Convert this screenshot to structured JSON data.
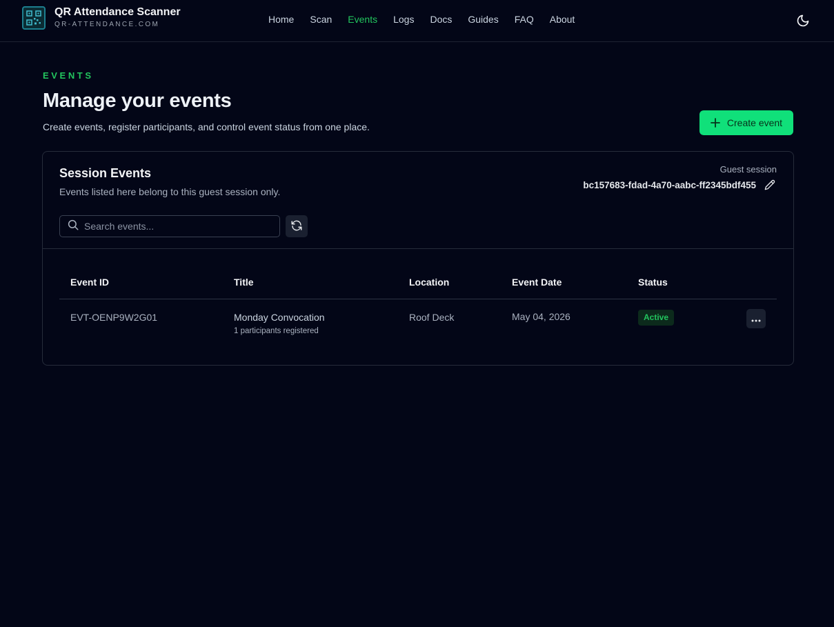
{
  "brand": {
    "title": "QR Attendance Scanner",
    "subtitle": "QR-ATTENDANCE.COM"
  },
  "nav": {
    "items": [
      {
        "label": "Home",
        "active": false
      },
      {
        "label": "Scan",
        "active": false
      },
      {
        "label": "Events",
        "active": true
      },
      {
        "label": "Logs",
        "active": false
      },
      {
        "label": "Docs",
        "active": false
      },
      {
        "label": "Guides",
        "active": false
      },
      {
        "label": "FAQ",
        "active": false
      },
      {
        "label": "About",
        "active": false
      }
    ],
    "theme_icon": "moon-icon"
  },
  "page": {
    "eyebrow": "EVENTS",
    "title": "Manage your events",
    "description": "Create events, register participants, and control event status from one place.",
    "create_button": "Create event"
  },
  "card": {
    "title": "Session Events",
    "subtitle": "Events listed here belong to this guest session only.",
    "session_label": "Guest session",
    "session_id": "bc157683-fdad-4a70-aabc-ff2345bdf455",
    "search_placeholder": "Search events...",
    "search_value": ""
  },
  "table": {
    "columns": [
      "Event ID",
      "Title",
      "Location",
      "Event Date",
      "Status"
    ],
    "rows": [
      {
        "event_id": "EVT-OENP9W2G01",
        "title": "Monday Convocation",
        "participants": "1 participants registered",
        "location": "Roof Deck",
        "date": "May 04, 2026",
        "status": "Active"
      }
    ]
  },
  "colors": {
    "background": "#030617",
    "accent": "#22c55e",
    "primary_button": "#10e07a",
    "border": "#262c3a"
  }
}
